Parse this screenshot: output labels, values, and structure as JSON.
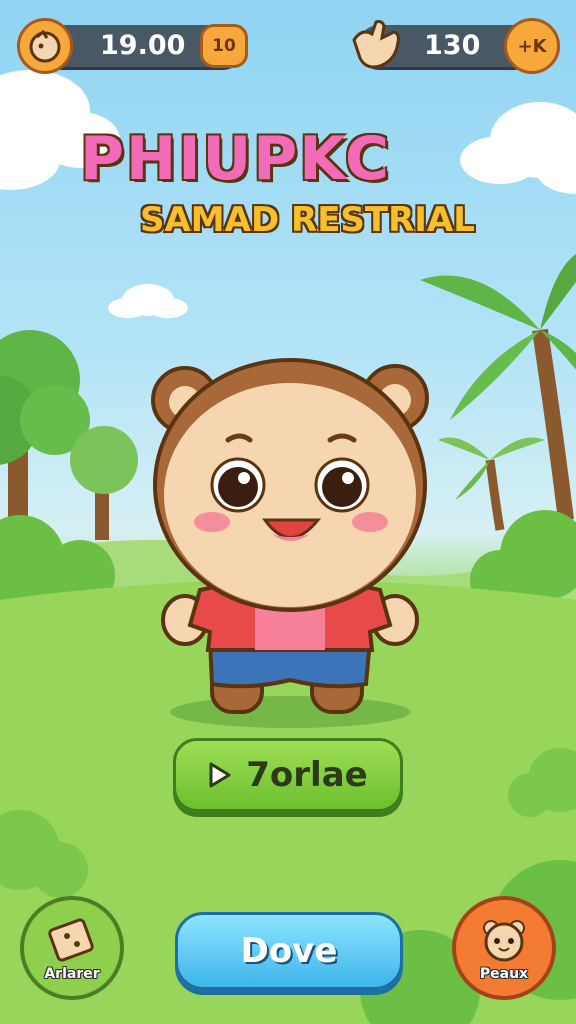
{
  "hud": {
    "left_count": "19.00",
    "left_badge": "10",
    "right_count": "130",
    "right_plus": "+K"
  },
  "title": {
    "line1": "PHIUPKC",
    "line2": "SAMAD RESTRIAL"
  },
  "buttons": {
    "play_label": "7orlae",
    "main_label": "Dove",
    "left_corner_label": "Arlarer",
    "right_corner_label": "Peaux"
  },
  "icons": {
    "coin": "coin-icon",
    "hand": "hand-icon",
    "play": "play-icon",
    "puzzle": "puzzle-icon",
    "character": "character-face-icon"
  },
  "colors": {
    "sky": "#8fd4f2",
    "grass": "#8bcf52",
    "play_button": "#7ccd3a",
    "main_button": "#4fc0ee",
    "orange": "#f47c32"
  }
}
